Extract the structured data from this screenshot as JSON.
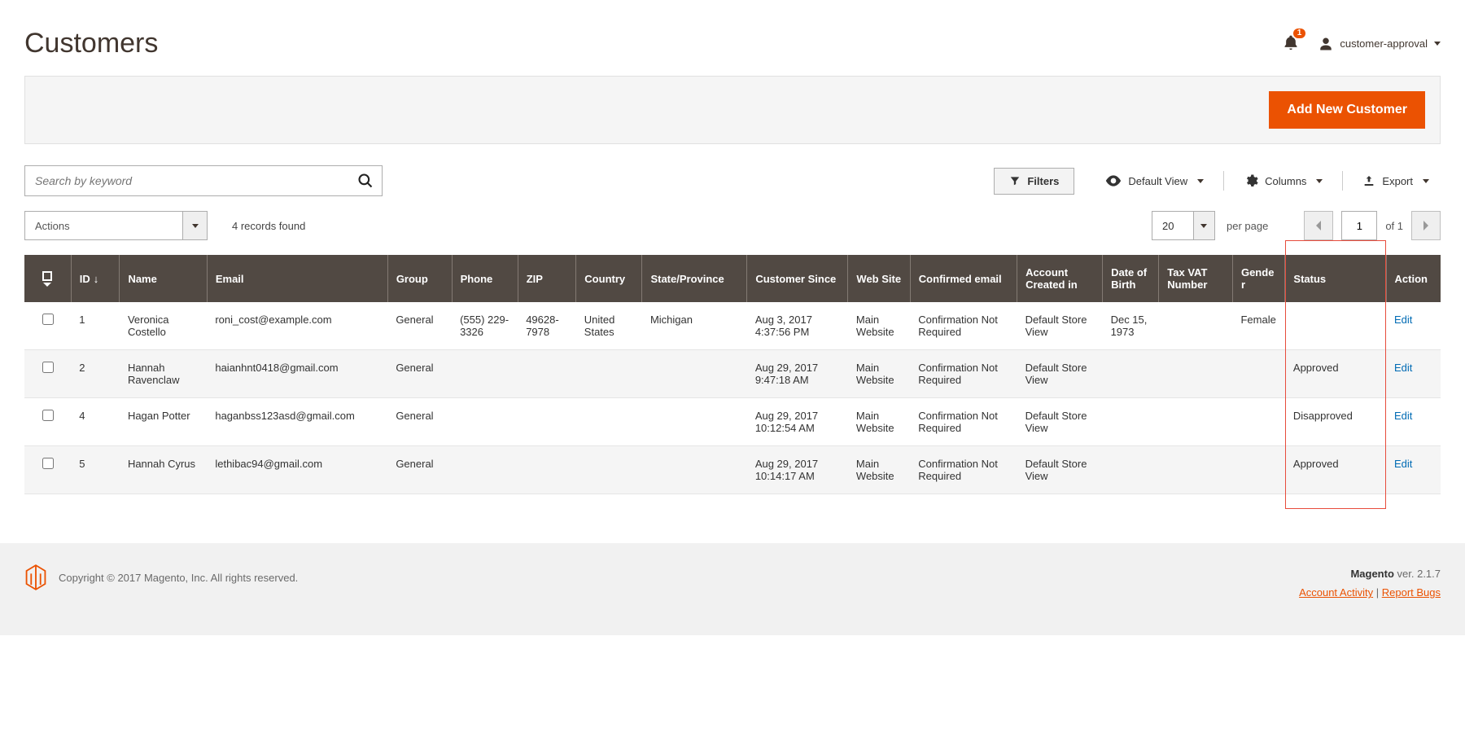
{
  "header": {
    "page_title": "Customers",
    "notif_count": "1",
    "user_label": "customer-approval"
  },
  "primary": {
    "add_button": "Add New Customer"
  },
  "search": {
    "placeholder": "Search by keyword"
  },
  "toolbar": {
    "filters": "Filters",
    "default_view": "Default View",
    "columns": "Columns",
    "export": "Export"
  },
  "listing": {
    "actions_label": "Actions",
    "records_found": "4 records found",
    "page_size": "20",
    "per_page": "per page",
    "page_current": "1",
    "page_of": "of 1"
  },
  "columns": {
    "id": "ID",
    "name": "Name",
    "email": "Email",
    "group": "Group",
    "phone": "Phone",
    "zip": "ZIP",
    "country": "Country",
    "state": "State/Province",
    "since": "Customer Since",
    "web": "Web Site",
    "confirmed": "Confirmed email",
    "account": "Account Created in",
    "dob": "Date of Birth",
    "vat": "Tax VAT Number",
    "gender": "Gender",
    "status": "Status",
    "action": "Action"
  },
  "rows": [
    {
      "id": "1",
      "name": "Veronica Costello",
      "email": "roni_cost@example.com",
      "group": "General",
      "phone": "(555) 229-3326",
      "zip": "49628-7978",
      "country": "United States",
      "state": "Michigan",
      "since": "Aug 3, 2017 4:37:56 PM",
      "web": "Main Website",
      "confirmed": "Confirmation Not Required",
      "account": "Default Store View",
      "dob": "Dec 15, 1973",
      "vat": "",
      "gender": "Female",
      "status": "",
      "action": "Edit"
    },
    {
      "id": "2",
      "name": "Hannah Ravenclaw",
      "email": "haianhnt0418@gmail.com",
      "group": "General",
      "phone": "",
      "zip": "",
      "country": "",
      "state": "",
      "since": "Aug 29, 2017 9:47:18 AM",
      "web": "Main Website",
      "confirmed": "Confirmation Not Required",
      "account": "Default Store View",
      "dob": "",
      "vat": "",
      "gender": "",
      "status": "Approved",
      "action": "Edit"
    },
    {
      "id": "4",
      "name": "Hagan Potter",
      "email": "haganbss123asd@gmail.com",
      "group": "General",
      "phone": "",
      "zip": "",
      "country": "",
      "state": "",
      "since": "Aug 29, 2017 10:12:54 AM",
      "web": "Main Website",
      "confirmed": "Confirmation Not Required",
      "account": "Default Store View",
      "dob": "",
      "vat": "",
      "gender": "",
      "status": "Disapproved",
      "action": "Edit"
    },
    {
      "id": "5",
      "name": "Hannah Cyrus",
      "email": "lethibac94@gmail.com",
      "group": "General",
      "phone": "",
      "zip": "",
      "country": "",
      "state": "",
      "since": "Aug 29, 2017 10:14:17 AM",
      "web": "Main Website",
      "confirmed": "Confirmation Not Required",
      "account": "Default Store View",
      "dob": "",
      "vat": "",
      "gender": "",
      "status": "Approved",
      "action": "Edit"
    }
  ],
  "footer": {
    "copyright": "Copyright © 2017 Magento, Inc. All rights reserved.",
    "brand": "Magento",
    "version": " ver. 2.1.7",
    "activity": "Account Activity",
    "bugs": "Report Bugs",
    "sep": "  |  "
  }
}
